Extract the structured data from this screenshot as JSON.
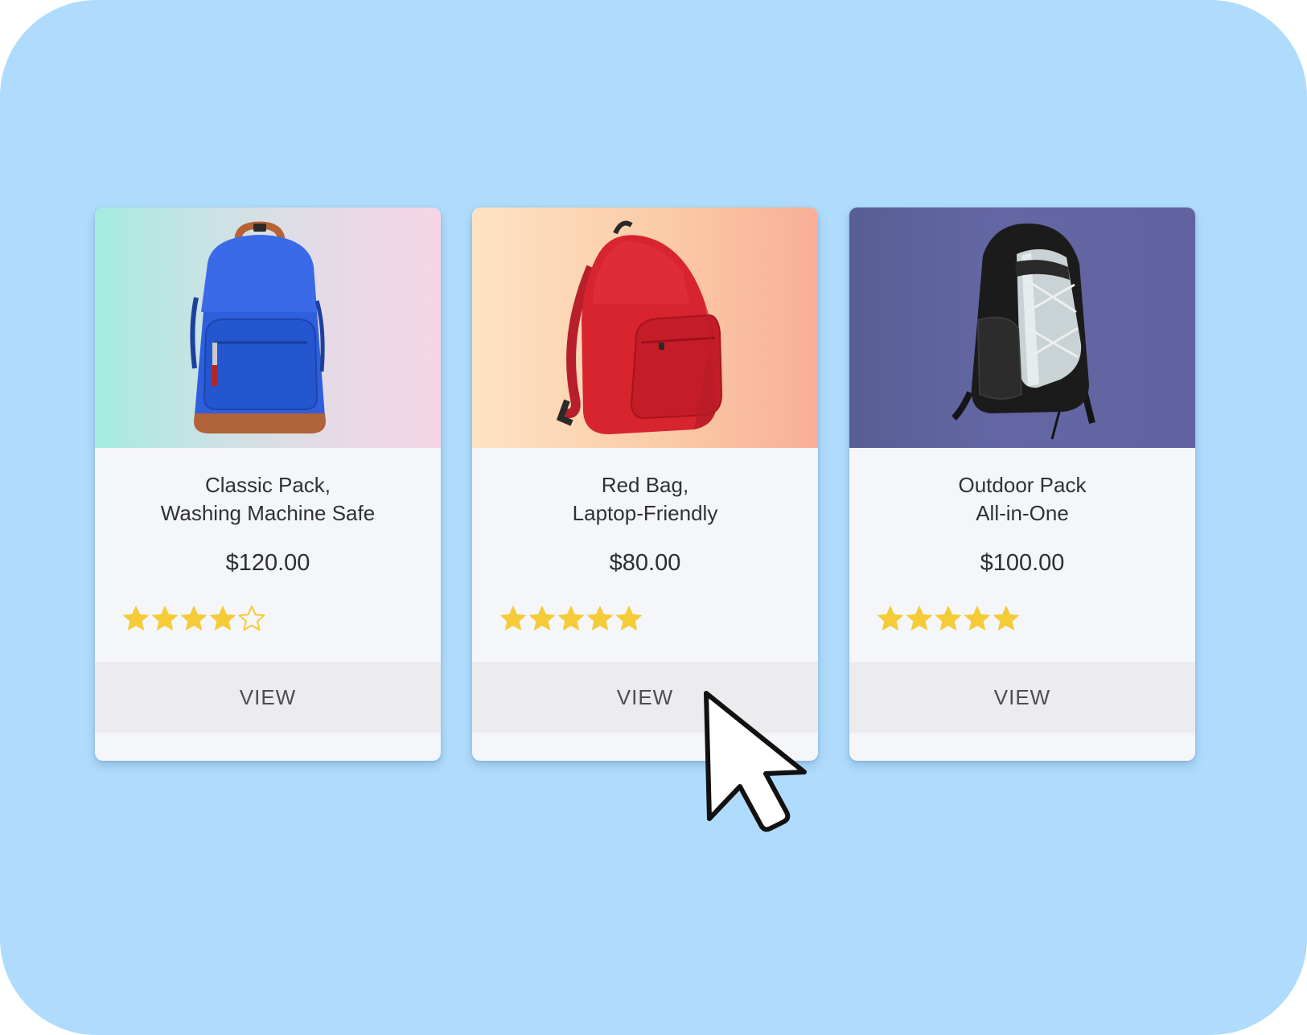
{
  "colors": {
    "background": "#afdcfc",
    "card": "#f4f6fa",
    "button": "#ececee",
    "star": "#f5cb38"
  },
  "products": [
    {
      "title_line1": "Classic Pack,",
      "title_line2": "Washing Machine Safe",
      "price": "$120.00",
      "rating": 4,
      "rating_max": 5,
      "button_label": "VIEW",
      "image": "blue-backpack"
    },
    {
      "title_line1": "Red Bag,",
      "title_line2": "Laptop-Friendly",
      "price": "$80.00",
      "rating": 5,
      "rating_max": 5,
      "button_label": "VIEW",
      "image": "red-backpack"
    },
    {
      "title_line1": "Outdoor Pack",
      "title_line2": "All-in-One",
      "price": "$100.00",
      "rating": 5,
      "rating_max": 5,
      "button_label": "VIEW",
      "image": "black-outdoor-backpack"
    }
  ],
  "cursor": "arrow-pointer-icon"
}
